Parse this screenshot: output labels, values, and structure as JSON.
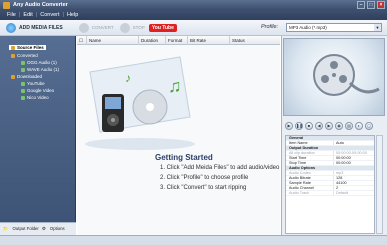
{
  "window": {
    "title": "Any Audio Converter"
  },
  "menu": [
    "File",
    "Edit",
    "Convert",
    "Help"
  ],
  "toolbar": {
    "add_label": "ADD MEDIA FILES",
    "convert_label": "CONVERT",
    "stop_label": "STOP",
    "youtube_label": "You Tube",
    "profile_label": "Profile:",
    "profile_value": "MP3 Audio (*.mp3)"
  },
  "sidebar": {
    "items": [
      {
        "label": "Source Files",
        "selected": true
      },
      {
        "label": "Converted"
      },
      {
        "label": "OGG Audio (1)"
      },
      {
        "label": "WAVE Audio (1)"
      },
      {
        "label": "Downloaded"
      },
      {
        "label": "YouTube"
      },
      {
        "label": "Google Video"
      },
      {
        "label": "Nico Video"
      }
    ],
    "output_folder_label": "Output Folder",
    "options_label": "Options"
  },
  "file_table": {
    "columns": [
      "Name",
      "Duration",
      "Format",
      "Bit Rate",
      "Status"
    ]
  },
  "getting_started": {
    "title": "Getting Started",
    "steps": [
      "1. Click \"Add Meida Files\" to add audio/video",
      "2. Click \"Profile\" to choose profile",
      "3. Click \"Convert\" to start ripping"
    ]
  },
  "properties": [
    {
      "key": "General",
      "value": "",
      "section": true
    },
    {
      "key": "Item Name",
      "value": "Auto"
    },
    {
      "key": "Output Duration",
      "value": "",
      "section": true
    },
    {
      "key": "All clip duration",
      "value": "00:00:00-00:00:00",
      "grey": true
    },
    {
      "key": "Start Time",
      "value": "00:00:00"
    },
    {
      "key": "Stop Time",
      "value": "00:00:00"
    },
    {
      "key": "Audio Options",
      "value": "",
      "section": true
    },
    {
      "key": "Audio Codec",
      "value": "mp3",
      "grey": true
    },
    {
      "key": "Audio Bitrate",
      "value": "128"
    },
    {
      "key": "Sample Rate",
      "value": "44100"
    },
    {
      "key": "Audio Channel",
      "value": "2"
    },
    {
      "key": "Audio Track",
      "value": "Default",
      "grey": true
    }
  ],
  "colors": {
    "accent": "#3b4d6b",
    "panel": "#566e92"
  }
}
